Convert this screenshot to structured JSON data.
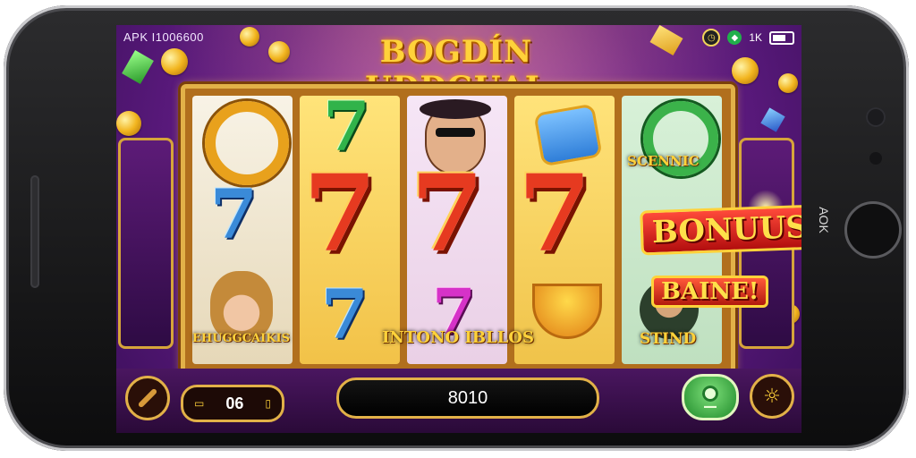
{
  "device": {
    "side_label": "AOK"
  },
  "status_bar": {
    "app_label": "APK I1006600",
    "signal_text": "1K"
  },
  "game": {
    "title": "BOGDÍN UDDGUAL",
    "reel_labels": {
      "reel1_bottom": "EHUGGCAIKIS",
      "reel5_top": "SCENNIC",
      "reel5_bottom": "STIND",
      "center_bottom": "INTONO IBLLOS"
    },
    "bonus_label": "BONUUS",
    "baine_label": "BAINE!",
    "bet_value": "06",
    "credits": "8010"
  },
  "icons": {
    "clock": "clock-icon",
    "shield": "shield-icon",
    "battery": "battery-icon",
    "menu": "wand-icon",
    "bet_minus": "minus-icon",
    "bet_plus": "plus-icon",
    "spin": "spin-icon",
    "settings": "sun-gear-icon"
  },
  "colors": {
    "accent_gold": "#e2b148",
    "background_purple": "#6a1f8e",
    "bonus_red": "#b20e0e",
    "spin_green": "#1f8a2a"
  }
}
